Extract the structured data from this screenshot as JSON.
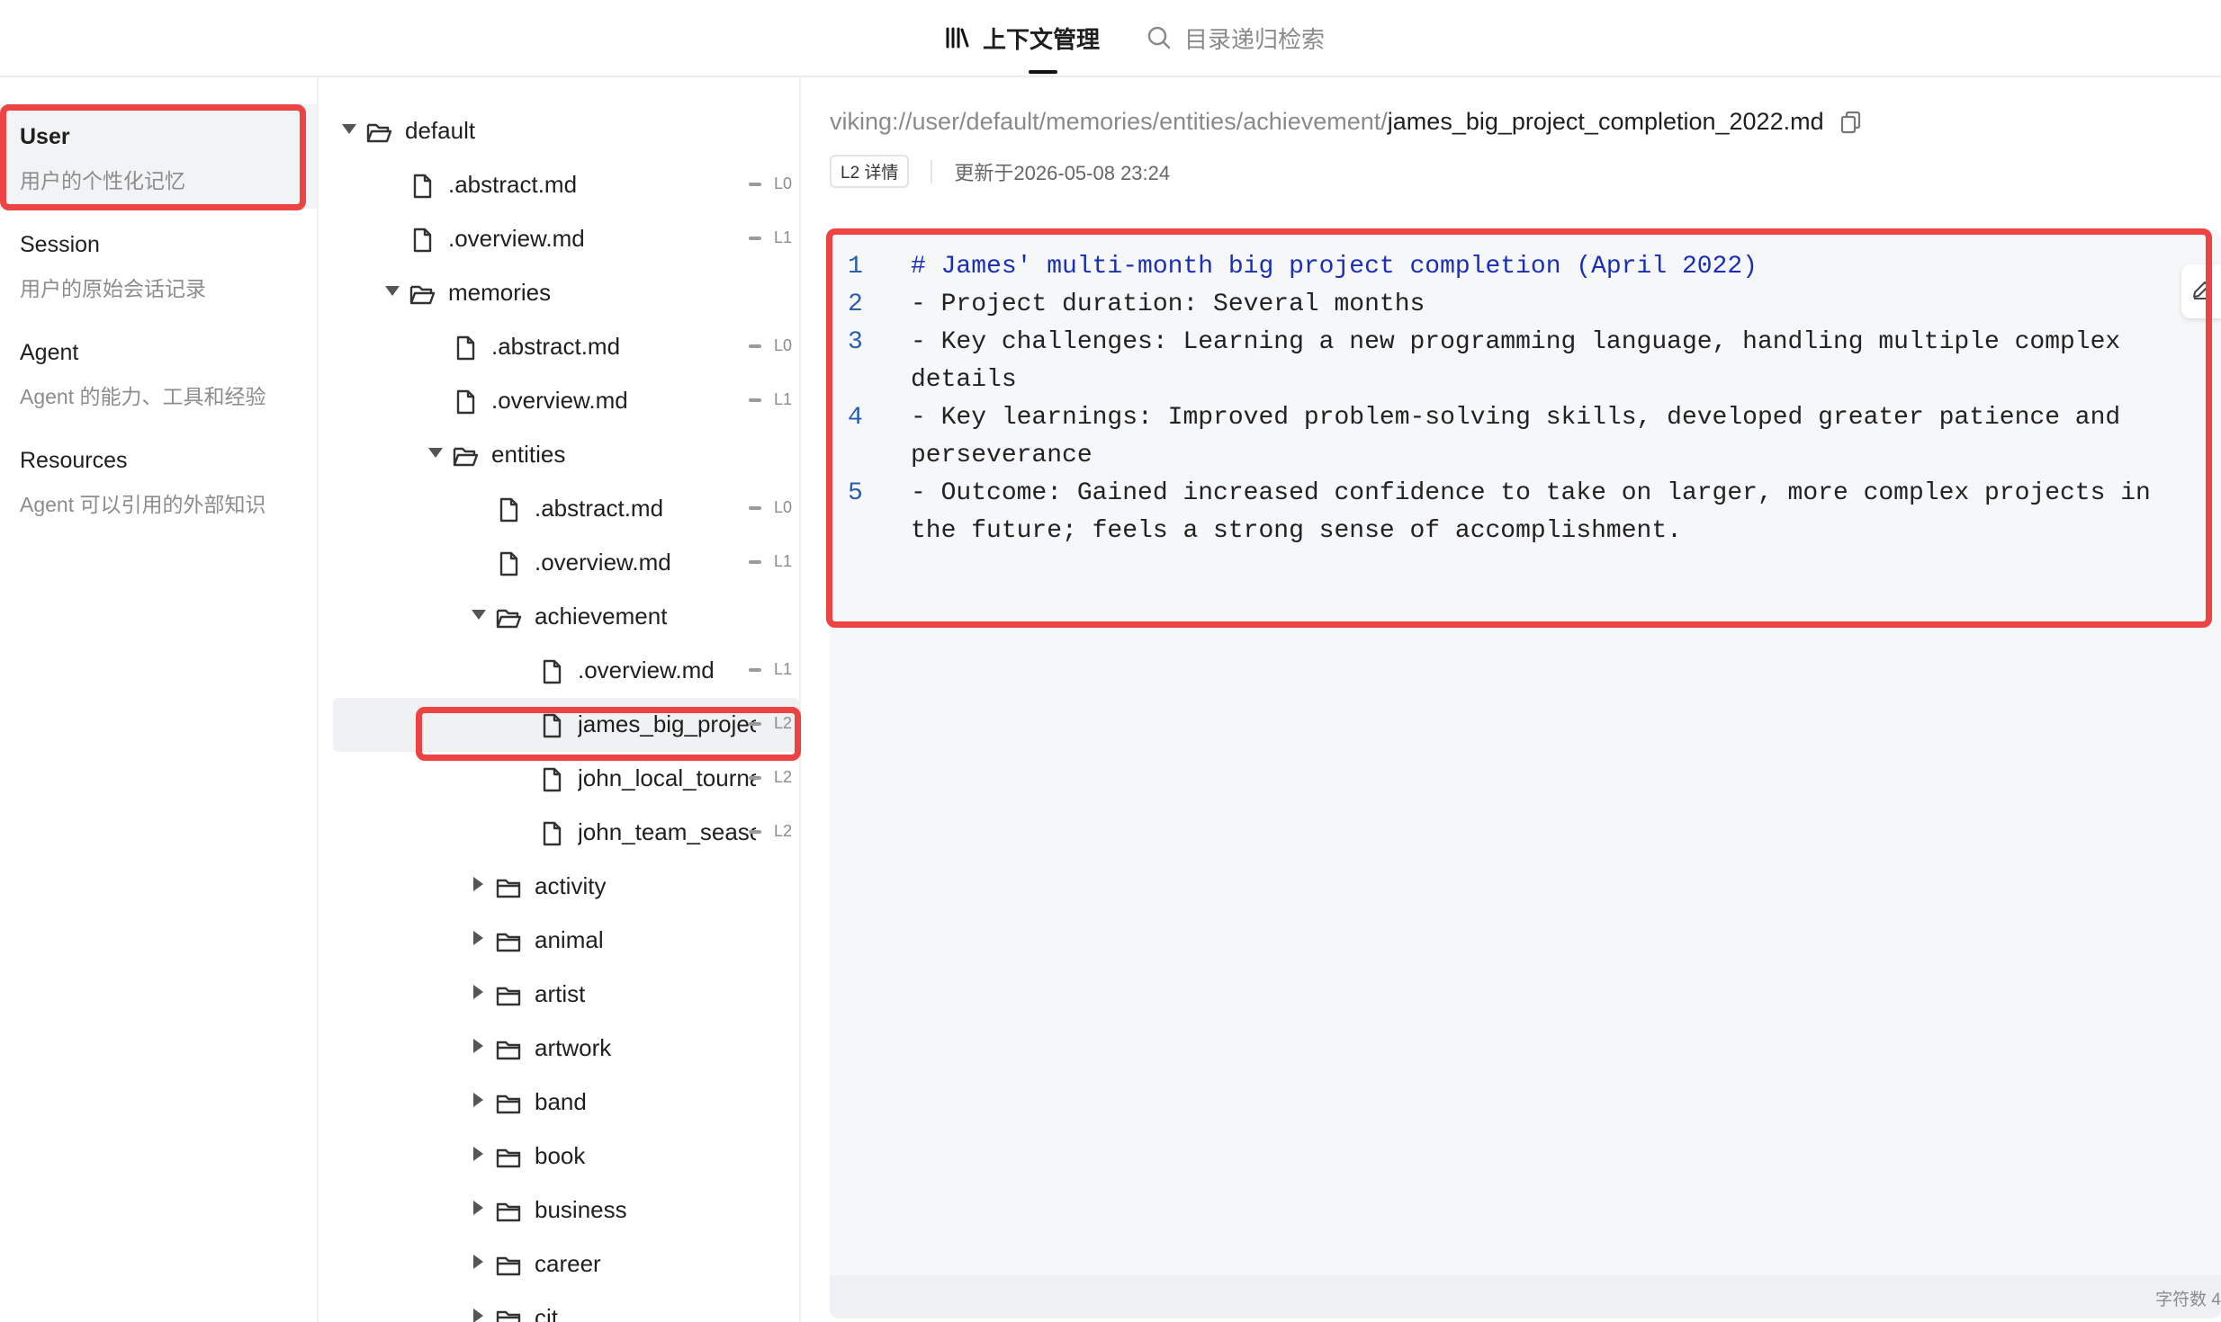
{
  "topbar": {
    "tabs": [
      {
        "label": "上下文管理",
        "icon": "library-icon",
        "active": true
      },
      {
        "label": "目录递归检索",
        "icon": "search-icon",
        "active": false
      }
    ]
  },
  "sidebar": {
    "items": [
      {
        "title": "User",
        "subtitle": "用户的个性化记忆",
        "active": true
      },
      {
        "title": "Session",
        "subtitle": "用户的原始会话记录"
      },
      {
        "title": "Agent",
        "subtitle": "Agent 的能力、工具和经验"
      },
      {
        "title": "Resources",
        "subtitle": "Agent 可以引用的外部知识"
      }
    ]
  },
  "tree": {
    "rows": [
      {
        "name": "default",
        "type": "folder",
        "expanded": true,
        "level": ""
      },
      {
        "name": ".abstract.md",
        "type": "file",
        "level": "L0"
      },
      {
        "name": ".overview.md",
        "type": "file",
        "level": "L1"
      },
      {
        "name": "memories",
        "type": "folder",
        "expanded": true,
        "level": ""
      },
      {
        "name": ".abstract.md",
        "type": "file",
        "level": "L0"
      },
      {
        "name": ".overview.md",
        "type": "file",
        "level": "L1"
      },
      {
        "name": "entities",
        "type": "folder",
        "expanded": true,
        "level": ""
      },
      {
        "name": ".abstract.md",
        "type": "file",
        "level": "L0"
      },
      {
        "name": ".overview.md",
        "type": "file",
        "level": "L1"
      },
      {
        "name": "achievement",
        "type": "folder",
        "expanded": true,
        "level": ""
      },
      {
        "name": ".overview.md",
        "type": "file",
        "level": "L1"
      },
      {
        "name": "james_big_projec",
        "type": "file",
        "level": "L2",
        "selected": true
      },
      {
        "name": "john_local_tourna",
        "type": "file",
        "level": "L2"
      },
      {
        "name": "john_team_seaso",
        "type": "file",
        "level": "L2"
      },
      {
        "name": "activity",
        "type": "folder",
        "expanded": false,
        "level": ""
      },
      {
        "name": "animal",
        "type": "folder",
        "expanded": false,
        "level": ""
      },
      {
        "name": "artist",
        "type": "folder",
        "expanded": false,
        "level": ""
      },
      {
        "name": "artwork",
        "type": "folder",
        "expanded": false,
        "level": ""
      },
      {
        "name": "band",
        "type": "folder",
        "expanded": false,
        "level": ""
      },
      {
        "name": "book",
        "type": "folder",
        "expanded": false,
        "level": ""
      },
      {
        "name": "business",
        "type": "folder",
        "expanded": false,
        "level": ""
      },
      {
        "name": "career",
        "type": "folder",
        "expanded": false,
        "level": ""
      },
      {
        "name": "cit",
        "type": "folder",
        "expanded": false,
        "level": ""
      }
    ]
  },
  "content": {
    "path_prefix": "viking://user/default/memories/entities/achievement/",
    "file_name": "james_big_project_completion_2022.md",
    "level_badge": "L2 详情",
    "updated": "更新于2026-05-08 23:24",
    "lines": [
      {
        "num": "1",
        "text": "# James' multi-month big project completion (April 2022)",
        "heading": true
      },
      {
        "num": "2",
        "text": "- Project duration: Several months"
      },
      {
        "num": "3",
        "text": "- Key challenges: Learning a new programming language, handling multiple complex details"
      },
      {
        "num": "4",
        "text": "- Key learnings: Improved problem-solving skills, developed greater patience and perseverance"
      },
      {
        "num": "5",
        "text": "- Outcome: Gained increased confidence to take on larger, more complex projects in the future; feels a strong sense of accomplishment."
      }
    ],
    "char_count": "字符数 4"
  },
  "colors": {
    "highlight": "#ec4343",
    "accent": "#111111",
    "line_number": "#2a5db0",
    "heading": "#1a2fb8"
  }
}
